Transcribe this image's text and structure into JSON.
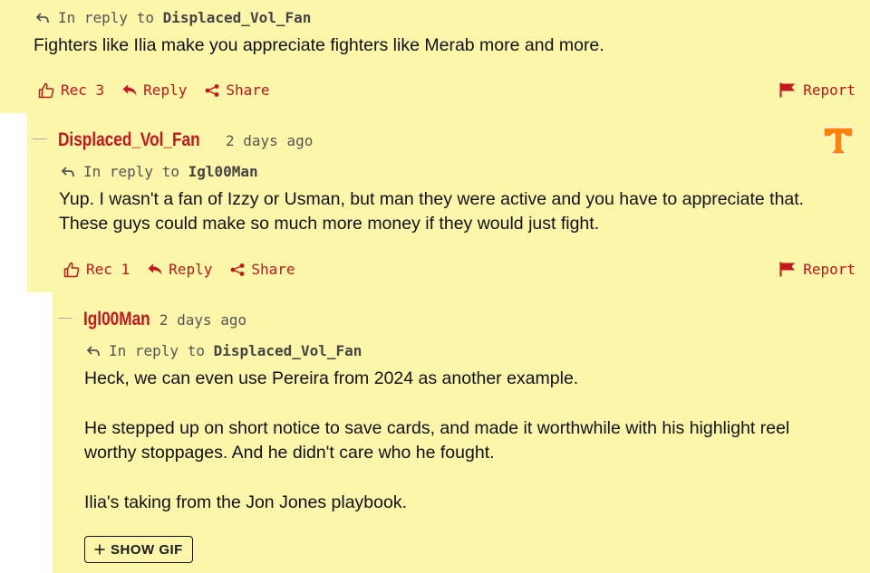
{
  "colors": {
    "accent": "#c4161c",
    "background": "#fbf6a9",
    "avatar": "#ff8200"
  },
  "comments": [
    {
      "reply_prefix": "In reply to",
      "reply_to": "Displaced_Vol_Fan",
      "body": [
        "Fighters like Ilia make you appreciate fighters like Merab more and more."
      ],
      "rec_label": "Rec 3",
      "reply_label": "Reply",
      "share_label": "Share",
      "report_label": "Report"
    },
    {
      "username": "Displaced_Vol_Fan",
      "timestamp": "2 days ago",
      "avatar_icon": "tennessee-t-logo",
      "reply_prefix": "In reply to",
      "reply_to": "Igl00Man",
      "body": [
        "Yup. I wasn't a fan of Izzy or Usman, but man they were active and you have to appreciate that. These guys could make so much more money if they would just fight."
      ],
      "rec_label": "Rec 1",
      "reply_label": "Reply",
      "share_label": "Share",
      "report_label": "Report"
    },
    {
      "username": "Igl00Man",
      "timestamp": "2 days ago",
      "reply_prefix": "In reply to",
      "reply_to": "Displaced_Vol_Fan",
      "body": [
        "Heck, we can even use Pereira from 2024 as another example.",
        "He stepped up on short notice to save cards, and made it worthwhile with his highlight reel worthy stoppages. And he didn't care who he fought.",
        "Ilia's taking from the Jon Jones playbook."
      ],
      "gif_label": "SHOW GIF"
    }
  ]
}
